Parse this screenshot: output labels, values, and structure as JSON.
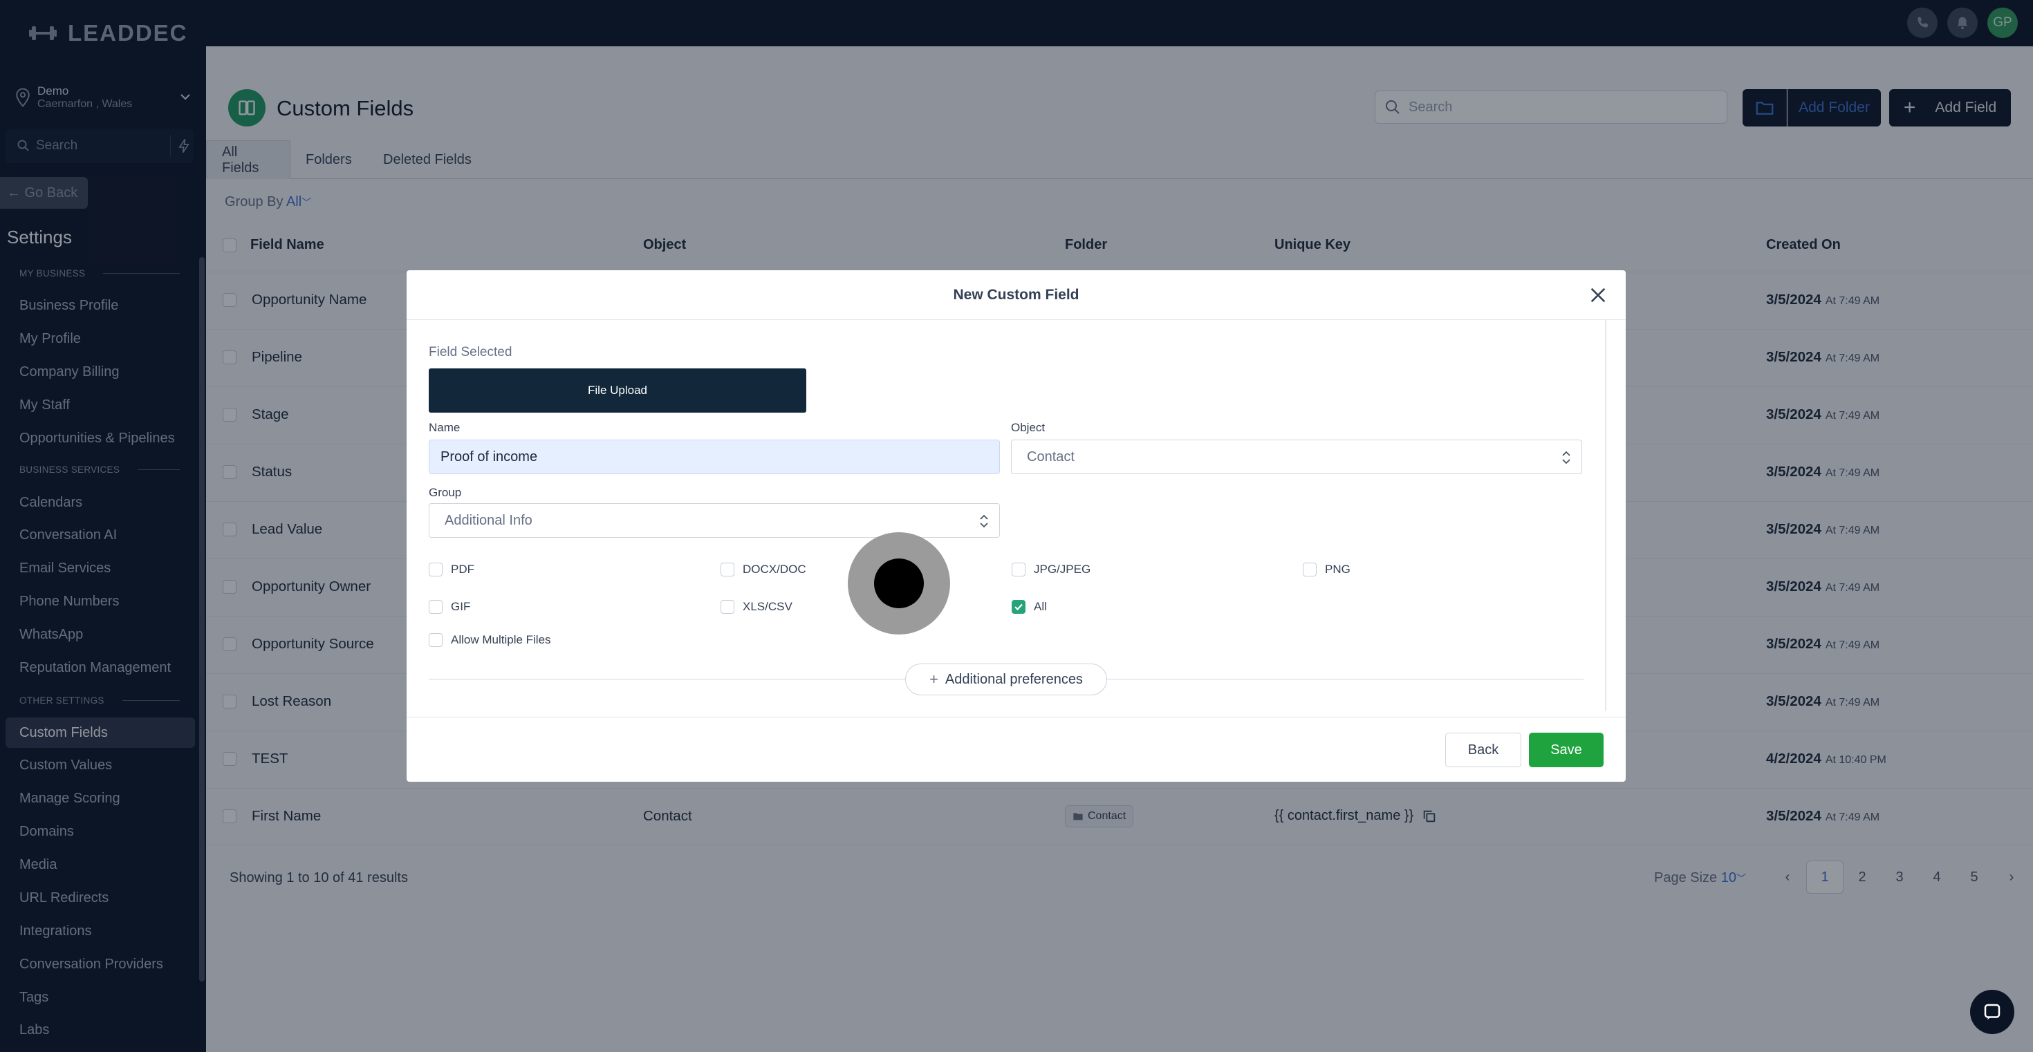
{
  "brand": {
    "logo_text": "LEADDEC"
  },
  "location": {
    "name": "Demo",
    "sub": "Caernarfon , Wales"
  },
  "sidebar": {
    "search_placeholder": "Search",
    "go_back": "← Go Back",
    "settings_title": "Settings",
    "sections": {
      "my_business": "MY BUSINESS",
      "business_services": "BUSINESS SERVICES",
      "other_settings": "OTHER SETTINGS"
    },
    "items": [
      "Business Profile",
      "My Profile",
      "Company Billing",
      "My Staff",
      "Opportunities & Pipelines",
      "Calendars",
      "Conversation AI",
      "Email Services",
      "Phone Numbers",
      "WhatsApp",
      "Reputation Management",
      "Custom Fields",
      "Custom Values",
      "Manage Scoring",
      "Domains",
      "Media",
      "URL Redirects",
      "Integrations",
      "Conversation Providers",
      "Tags",
      "Labs"
    ],
    "active_item": "Custom Fields"
  },
  "topbar": {
    "avatar_initials": "GP"
  },
  "page": {
    "title": "Custom Fields",
    "search_placeholder": "Search",
    "add_folder": "Add Folder",
    "add_field": "Add Field",
    "tabs": [
      "All Fields",
      "Folders",
      "Deleted Fields"
    ],
    "group_by_label": "Group By",
    "group_by_value": "All"
  },
  "table": {
    "headers": [
      "Field Name",
      "Object",
      "Folder",
      "Unique Key",
      "Created On"
    ],
    "rows": [
      {
        "name": "Opportunity Name",
        "object": "",
        "folder": "",
        "key": "",
        "date": "3/5/2024",
        "time": "At 7:49 AM"
      },
      {
        "name": "Pipeline",
        "object": "",
        "folder": "",
        "key": "",
        "date": "3/5/2024",
        "time": "At 7:49 AM"
      },
      {
        "name": "Stage",
        "object": "",
        "folder": "",
        "key": "",
        "date": "3/5/2024",
        "time": "At 7:49 AM"
      },
      {
        "name": "Status",
        "object": "",
        "folder": "",
        "key": "",
        "date": "3/5/2024",
        "time": "At 7:49 AM"
      },
      {
        "name": "Lead Value",
        "object": "",
        "folder": "",
        "key": "",
        "date": "3/5/2024",
        "time": "At 7:49 AM"
      },
      {
        "name": "Opportunity Owner",
        "object": "",
        "folder": "",
        "key": "",
        "date": "3/5/2024",
        "time": "At 7:49 AM"
      },
      {
        "name": "Opportunity Source",
        "object": "",
        "folder": "",
        "key": "",
        "date": "3/5/2024",
        "time": "At 7:49 AM"
      },
      {
        "name": "Lost Reason",
        "object": "",
        "folder": "",
        "key": "",
        "date": "3/5/2024",
        "time": "At 7:49 AM"
      },
      {
        "name": "TEST",
        "object": "",
        "folder": "",
        "key": "",
        "date": "4/2/2024",
        "time": "At 10:40 PM"
      },
      {
        "name": "First Name",
        "object": "Contact",
        "folder": "Contact",
        "key": "{{ contact.first_name }}",
        "date": "3/5/2024",
        "time": "At 7:49 AM"
      }
    ],
    "showing_text": "Showing 1 to 10 of 41 results",
    "page_size_label": "Page Size",
    "page_size_value": "10",
    "pages": [
      "1",
      "2",
      "3",
      "4",
      "5"
    ],
    "current_page": "1"
  },
  "modal": {
    "title": "New Custom Field",
    "field_selected_label": "Field Selected",
    "field_type": "File Upload",
    "name_label": "Name",
    "name_value": "Proof of income",
    "object_label": "Object",
    "object_value": "Contact",
    "group_label": "Group",
    "group_value": "Additional Info",
    "file_types": [
      {
        "label": "PDF",
        "checked": false
      },
      {
        "label": "DOCX/DOC",
        "checked": false
      },
      {
        "label": "JPG/JPEG",
        "checked": false
      },
      {
        "label": "PNG",
        "checked": false
      },
      {
        "label": "GIF",
        "checked": false
      },
      {
        "label": "XLS/CSV",
        "checked": false
      },
      {
        "label": "All",
        "checked": true
      }
    ],
    "allow_multiple_label": "Allow Multiple Files",
    "allow_multiple_checked": false,
    "additional_preferences": "Additional preferences",
    "back": "Back",
    "save": "Save"
  },
  "colors": {
    "sidebar_bg": "#0a1326",
    "accent_blue": "#3b6fd4",
    "save_green": "#1ea33e",
    "check_green": "#27a37a",
    "field_type_bg": "#12283a"
  }
}
